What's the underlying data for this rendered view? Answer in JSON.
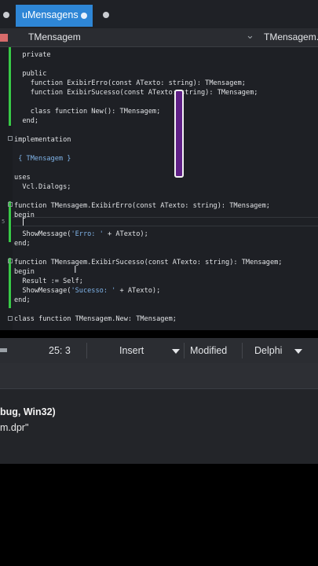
{
  "tabs": {
    "active_label": "uMensagens"
  },
  "navbar": {
    "left_label": "TMensagem",
    "right_label": "TMensagem."
  },
  "code": {
    "l1": "  private",
    "l2": "  public",
    "l3": "    function ExibirErro(const ATexto: string): TMensagem;",
    "l4": "    function ExibirSucesso(const ATexto: string): TMensagem;",
    "l5": "    class function New(): TMensagem;",
    "l6": "  end;",
    "l7": "implementation",
    "l8a": "{ TMensagem }",
    "l9": "uses",
    "l10": "  Vcl.Dialogs;",
    "l11": "function TMensagem.ExibirErro(const ATexto: string): TMensagem;",
    "l12": "begin",
    "l13a": "  ShowMessage(",
    "l13b": "'Erro: '",
    "l13c": " + ATexto);",
    "l14": "end;",
    "l15": "function TMensagem.ExibirSucesso(const ATexto: string): TMensagem;",
    "l16": "begin",
    "l17": "  Result := Self;",
    "l18a": "  ShowMessage(",
    "l18b": "'Sucesso: '",
    "l18c": " + ATexto);",
    "l19": "end;",
    "l20": "class function TMensagem.New: TMensagem;"
  },
  "status": {
    "position": "25:  3",
    "mode": "Insert",
    "state": "Modified",
    "language": "Delphi"
  },
  "messages": {
    "line1": "bug, Win32)",
    "line2": "m.dpr\""
  },
  "colors": {
    "tab_active": "#2e86d6",
    "modified_bar": "#38c947",
    "overlay": "#5f1f86"
  }
}
